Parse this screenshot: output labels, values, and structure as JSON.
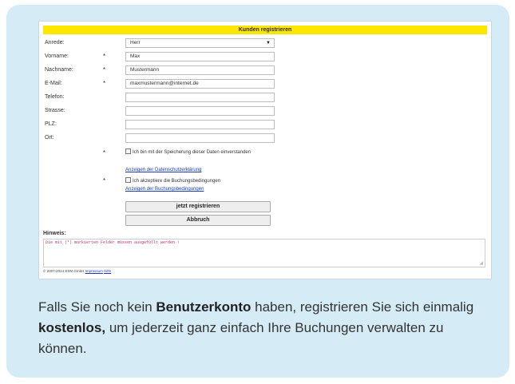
{
  "form": {
    "title": "Kunden registrieren",
    "fields": [
      {
        "label": "Anrede:",
        "required": "",
        "value": "Herr",
        "type": "select"
      },
      {
        "label": "Vorname:",
        "required": "*",
        "value": "Max",
        "type": "text"
      },
      {
        "label": "Nachname:",
        "required": "*",
        "value": "Mustermann",
        "type": "text"
      },
      {
        "label": "E-Mail:",
        "required": "*",
        "value": "maxmustermann@internet.de",
        "type": "text"
      },
      {
        "label": "Telefon:",
        "required": "",
        "value": "",
        "type": "text"
      },
      {
        "label": "Strasse:",
        "required": "",
        "value": "",
        "type": "text"
      },
      {
        "label": "PLZ:",
        "required": "",
        "value": "",
        "type": "text"
      },
      {
        "label": "Ort:",
        "required": "",
        "value": "",
        "type": "text"
      }
    ],
    "consent_required": "*",
    "consent_text": "Ich bin mit der Speicherung dieser Daten einverstanden",
    "privacy_link": "Anzeigen der Datenschutzerklärung",
    "terms_required": "*",
    "terms_text": "Ich akzeptiere die Buchungsbedingungen",
    "terms_link": "Anzeigen der Buchungsbedingungen",
    "submit_label": "jetzt registrieren",
    "cancel_label": "Abbruch",
    "hint_label": "Hinweis:",
    "hint_text": "Die mit (*) markierten Felder müssen ausgefüllt werden !",
    "footer_copyright": "© 2007-2014 ESM GmbH",
    "footer_impressum": "Impressum",
    "footer_hilfe": "Hilfe"
  },
  "caption": {
    "part1": "Falls Sie noch kein ",
    "bold1": "Benutzerkonto",
    "part2": " haben, registrieren Sie sich einmalig ",
    "bold2": "kostenlos,",
    "part3": " um jederzeit ganz einfach Ihre Buchungen verwalten zu können."
  },
  "colors": {
    "card_background": "#d5ecf7",
    "title_bar": "#ffe600",
    "link": "#1a3bb0",
    "hint_text": "#c0306a"
  }
}
